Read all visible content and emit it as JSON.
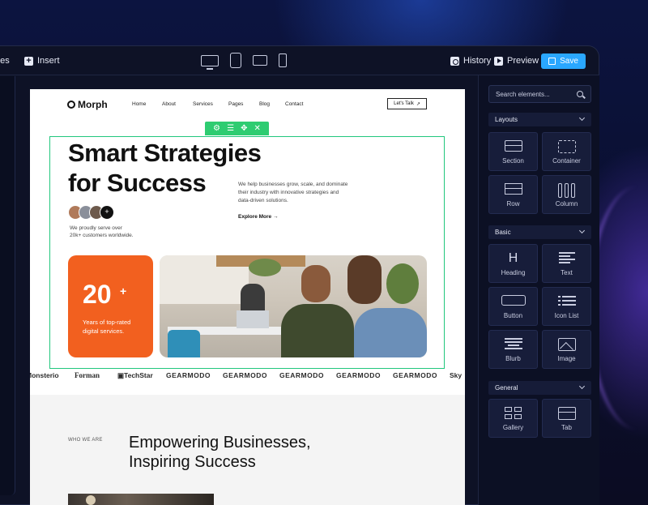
{
  "topbar": {
    "pages_label": "ges",
    "insert_label": "Insert",
    "history_label": "History",
    "preview_label": "Preview",
    "save_label": "Save",
    "devices": [
      "desktop-icon",
      "tablet-icon",
      "tablet-landscape-icon",
      "phone-icon"
    ]
  },
  "site": {
    "logo": "Morph",
    "nav": [
      "Home",
      "About",
      "Services",
      "Pages",
      "Blog",
      "Contact"
    ],
    "cta": "Let's Talk",
    "hero_title_line1": "Smart Strategies",
    "hero_title_line2": "for Success",
    "hero_desc": "We help businesses grow, scale, and dominate their industry with innovative strategies and data-driven solutions.",
    "explore": "Explore More",
    "proud_line1": "We proudly serve over",
    "proud_line2": "20k+ customers worldwide.",
    "avatar_plus": "+",
    "stat_number": "20",
    "stat_plus": "+",
    "stat_text": "Years of top-rated digital services.",
    "logos": [
      "Monsterio",
      "Forman",
      "TechStar",
      "GEARMODO",
      "GEARMODO",
      "GEARMODO",
      "GEARMODO",
      "GEARMODO",
      "Sky"
    ],
    "who_label": "WHO WE ARE",
    "who_title_line1": "Empowering Businesses,",
    "who_title_line2": "Inspiring Success"
  },
  "panel": {
    "search_placeholder": "Search elements...",
    "sections": [
      {
        "title": "Layouts",
        "items": [
          "Section",
          "Container",
          "Row",
          "Column"
        ]
      },
      {
        "title": "Basic",
        "items": [
          "Heading",
          "Text",
          "Button",
          "Icon List",
          "Blurb",
          "Image"
        ]
      },
      {
        "title": "General",
        "items": [
          "Gallery",
          "Tab"
        ]
      }
    ],
    "heading_glyph": "H"
  },
  "colors": {
    "accent": "#2aa7ff",
    "selection": "#2ecc71",
    "stat_card": "#f2601f",
    "panel_bg": "#0c1024"
  }
}
